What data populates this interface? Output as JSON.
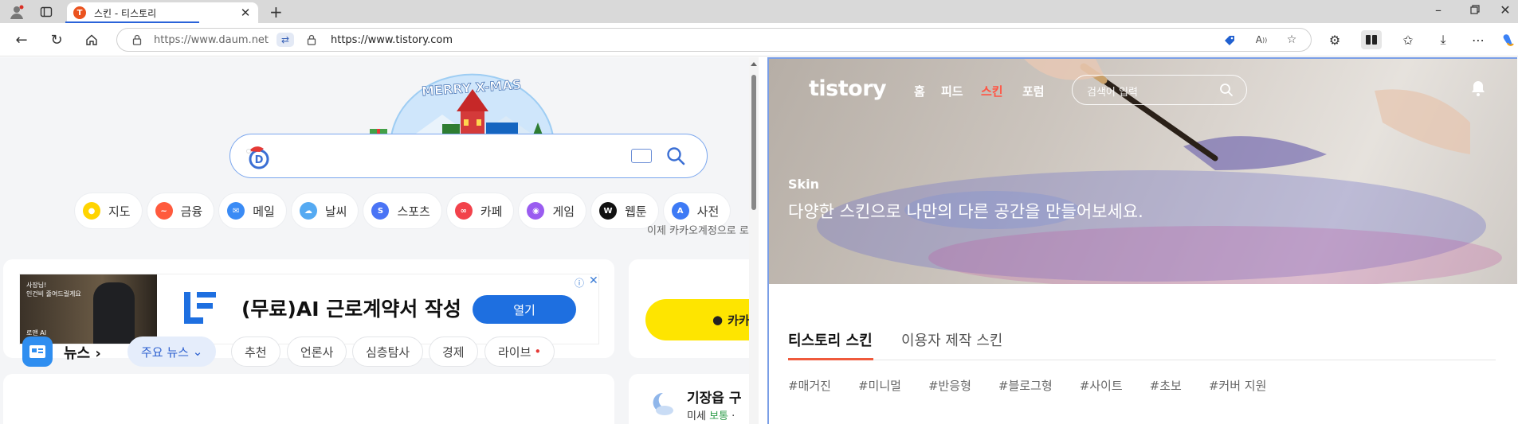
{
  "browser": {
    "tab_title": "스킨 - 티스토리",
    "tab_favicon_letter": "T",
    "left_url": "https://www.daum.net",
    "right_url": "https://www.tistory.com"
  },
  "daum": {
    "logo_banner_text": "MERRY X-MAS",
    "categories": [
      {
        "label": "지도",
        "icon": "map-pin-icon",
        "color": "#ffd400"
      },
      {
        "label": "금융",
        "icon": "chart-icon",
        "color": "#ff5a3d"
      },
      {
        "label": "메일",
        "icon": "mail-icon",
        "color": "#3a8bf5"
      },
      {
        "label": "날씨",
        "icon": "weather-icon",
        "color": "#55aaf2"
      },
      {
        "label": "스포츠",
        "icon": "sports-icon",
        "color": "#4a74f5"
      },
      {
        "label": "카페",
        "icon": "cafe-icon",
        "color": "#f2424b"
      },
      {
        "label": "게임",
        "icon": "game-icon",
        "color": "#9a5cf0"
      },
      {
        "label": "웹툰",
        "icon": "webtoon-icon",
        "color": "#111111"
      },
      {
        "label": "사전",
        "icon": "dictionary-icon",
        "color": "#3d7af5"
      }
    ],
    "ad": {
      "image_text_1": "사장님!",
      "image_text_2": "인건비 줄여드릴게요",
      "image_brand": "로앤 AI",
      "headline": "(무료)AI 근로계약서 작성",
      "button": "열기",
      "info_icon": "ⓘ",
      "close_icon": "✕"
    },
    "kakao_note": "이제 카카오계정으로 로",
    "kakao_button": "카카",
    "news_title": "뉴스",
    "news_chevron": "›",
    "news_tabs": [
      "주요 뉴스",
      "추천",
      "언론사",
      "심층탐사",
      "경제",
      "라이브"
    ],
    "news_dropdown": "⌄",
    "live_dot": "•",
    "weather_title": "기장읍 구",
    "weather_sub_label": "미세",
    "weather_sub_value": "보통"
  },
  "tistory": {
    "logo": "tistory",
    "nav": [
      "홈",
      "피드",
      "스킨",
      "포럼"
    ],
    "nav_active_index": 2,
    "search_placeholder": "검색어 입력",
    "hero_kicker": "Skin",
    "hero_title": "다양한 스킨으로 나만의 다른 공간을 만들어보세요.",
    "tabs": [
      "티스토리 스킨",
      "이용자 제작 스킨"
    ],
    "tags": [
      "#매거진",
      "#미니멀",
      "#반응형",
      "#블로그형",
      "#사이트",
      "#초보",
      "#커버 지원"
    ],
    "accent": "#ef5a3c"
  }
}
